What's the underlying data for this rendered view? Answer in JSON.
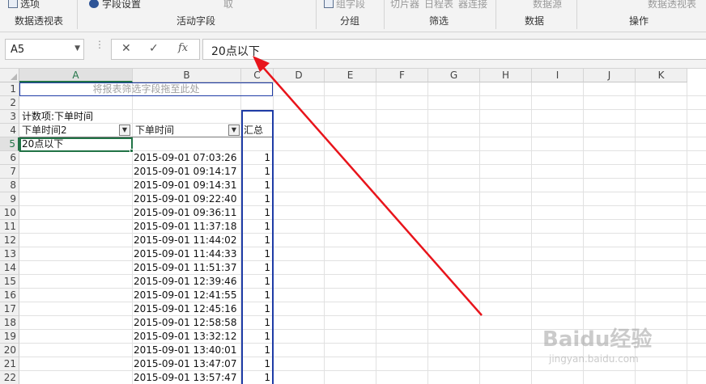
{
  "ribbon": {
    "groups": [
      {
        "label": "数据透视表",
        "items": [
          "选项"
        ]
      },
      {
        "label": "活动字段",
        "items": [
          "字段设置",
          "取"
        ]
      },
      {
        "label": "分组",
        "items": [
          "组字段"
        ]
      },
      {
        "label": "筛选",
        "items": [
          "切片器",
          "日程表",
          "器连接"
        ]
      },
      {
        "label": "数据",
        "items": [
          "数据源"
        ]
      },
      {
        "label": "操作",
        "items": [
          "数据透视表"
        ]
      }
    ]
  },
  "formula_bar": {
    "name_box": "A5",
    "cancel_icon": "close-icon",
    "enter_icon": "check-icon",
    "function_label": "fx",
    "content": "20点以下"
  },
  "columns": [
    "A",
    "B",
    "C",
    "D",
    "E",
    "F",
    "G",
    "H",
    "I",
    "J",
    "K"
  ],
  "rows": [
    "1",
    "2",
    "3",
    "4",
    "5",
    "6",
    "7",
    "8",
    "9",
    "10",
    "11",
    "12",
    "13",
    "14",
    "15",
    "16",
    "17",
    "18",
    "19",
    "20",
    "21",
    "22"
  ],
  "selected_cell": "A5",
  "pivot": {
    "filter_drop_hint": "将报表筛选字段拖至此处",
    "count_label": "计数项:下单时间",
    "field_headers": [
      "下单时间2",
      "下单时间",
      "汇总"
    ],
    "group_label": "20点以下",
    "rows": [
      {
        "time": "2015-09-01 07:03:26",
        "count": "1"
      },
      {
        "time": "2015-09-01 09:14:17",
        "count": "1"
      },
      {
        "time": "2015-09-01 09:14:31",
        "count": "1"
      },
      {
        "time": "2015-09-01 09:22:40",
        "count": "1"
      },
      {
        "time": "2015-09-01 09:36:11",
        "count": "1"
      },
      {
        "time": "2015-09-01 11:37:18",
        "count": "1"
      },
      {
        "time": "2015-09-01 11:44:02",
        "count": "1"
      },
      {
        "time": "2015-09-01 11:44:33",
        "count": "1"
      },
      {
        "time": "2015-09-01 11:51:37",
        "count": "1"
      },
      {
        "time": "2015-09-01 12:39:46",
        "count": "1"
      },
      {
        "time": "2015-09-01 12:41:55",
        "count": "1"
      },
      {
        "time": "2015-09-01 12:45:16",
        "count": "1"
      },
      {
        "time": "2015-09-01 12:58:58",
        "count": "1"
      },
      {
        "time": "2015-09-01 13:32:12",
        "count": "1"
      },
      {
        "time": "2015-09-01 13:40:01",
        "count": "1"
      },
      {
        "time": "2015-09-01 13:47:07",
        "count": "1"
      },
      {
        "time": "2015-09-01 13:57:47",
        "count": "1"
      }
    ]
  },
  "colors": {
    "annotation_arrow": "#e8141b",
    "pivot_border": "#1f3ca6",
    "selection": "#217346"
  },
  "watermark": {
    "brand": "Baidu经验",
    "url": "jingyan.baidu.com"
  }
}
